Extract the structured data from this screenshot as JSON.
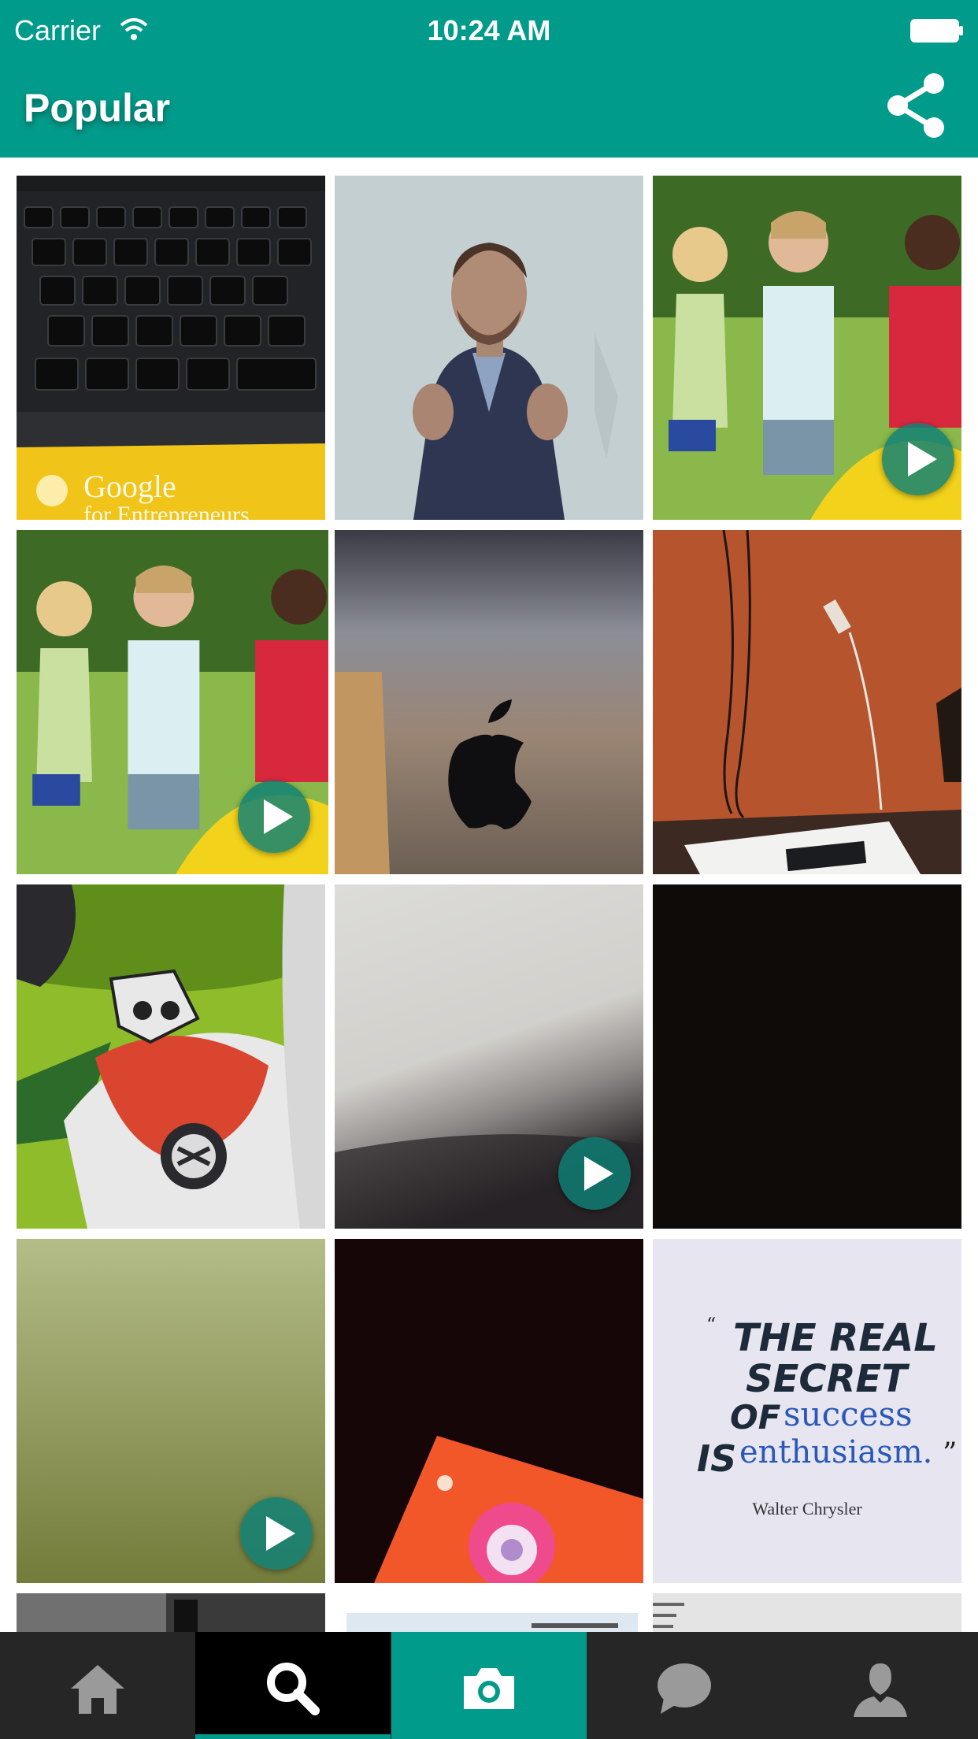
{
  "status": {
    "carrier": "Carrier",
    "time": "10:24 AM"
  },
  "header": {
    "title": "Popular"
  },
  "colors": {
    "accent": "#009b8a",
    "tabbar": "#262626",
    "active_search": "#000000"
  },
  "grid": {
    "tiles": [
      {
        "subject": "laptop keyboard with Google for Entrepreneurs card",
        "video": false
      },
      {
        "subject": "man speaking on projected screen",
        "video": false
      },
      {
        "subject": "children playing with ball",
        "video": true
      },
      {
        "subject": "children playing with ball",
        "video": true
      },
      {
        "subject": "apple logo on laptop lid",
        "video": false
      },
      {
        "subject": "orange wall with cables",
        "video": false
      },
      {
        "subject": "cartoon character",
        "video": false
      },
      {
        "subject": "blurry grey",
        "video": true
      },
      {
        "subject": "dark image",
        "video": false
      },
      {
        "subject": "green gradient",
        "video": true
      },
      {
        "subject": "dark with orange phone screen",
        "video": false
      },
      {
        "subject": "quote image",
        "video": false
      }
    ],
    "quote": {
      "line1": "THE REAL",
      "line2": "SECRET",
      "line3a": "OF",
      "line3b": "success",
      "line4a": "IS",
      "line4b": "enthusiasm.",
      "author": "Walter Chrysler"
    },
    "card_text": "Google",
    "card_text_2": "for Entrepreneurs"
  },
  "tabbar": {
    "tabs": [
      {
        "icon": "home-icon",
        "active": false
      },
      {
        "icon": "search-icon",
        "active": true
      },
      {
        "icon": "camera-icon",
        "active": false
      },
      {
        "icon": "chat-icon",
        "active": false
      },
      {
        "icon": "profile-icon",
        "active": false
      }
    ]
  }
}
